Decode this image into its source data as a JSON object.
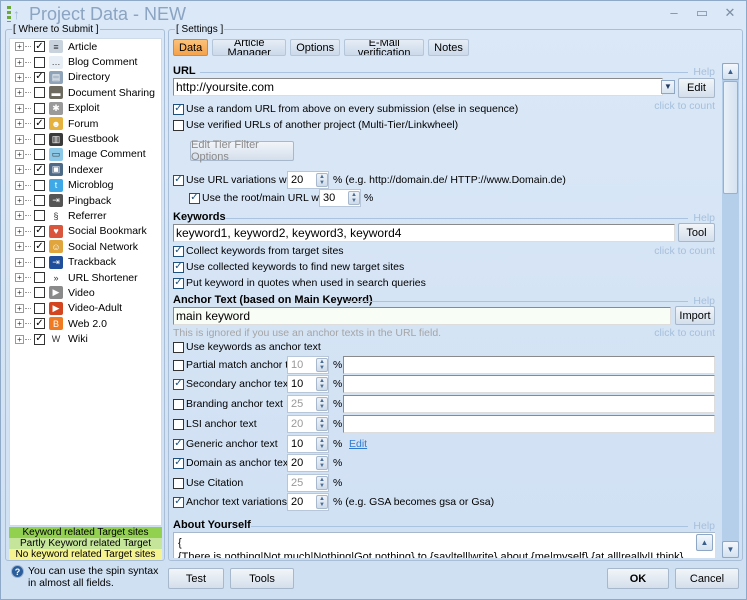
{
  "window": {
    "title": "Project Data - NEW",
    "controls": {
      "minimize": "–",
      "maximize": "▭",
      "close": "✕"
    }
  },
  "left_panel": {
    "group_label": "[ Where to Submit ]",
    "items": [
      {
        "label": "Article",
        "checked": true,
        "icon": "article-icon",
        "icon_color": "#c9d3de"
      },
      {
        "label": "Blog Comment",
        "checked": false,
        "icon": "speech-bubble-icon",
        "icon_color": "#e7eef6"
      },
      {
        "label": "Directory",
        "checked": true,
        "icon": "directory-icon",
        "icon_color": "#8fa3b9"
      },
      {
        "label": "Document Sharing",
        "checked": false,
        "icon": "folder-icon",
        "icon_color": "#6d6a5f"
      },
      {
        "label": "Exploit",
        "checked": false,
        "icon": "bug-icon",
        "icon_color": "#9a9a9a"
      },
      {
        "label": "Forum",
        "checked": true,
        "icon": "users-icon",
        "icon_color": "#e6b23f"
      },
      {
        "label": "Guestbook",
        "checked": false,
        "icon": "book-icon",
        "icon_color": "#3a3a3a"
      },
      {
        "label": "Image Comment",
        "checked": false,
        "icon": "image-icon",
        "icon_color": "#8cc8e8"
      },
      {
        "label": "Indexer",
        "checked": true,
        "icon": "indexer-icon",
        "icon_color": "#4d6a87"
      },
      {
        "label": "Microblog",
        "checked": false,
        "icon": "twitter-icon",
        "icon_color": "#3fa9e8"
      },
      {
        "label": "Pingback",
        "checked": false,
        "icon": "pingback-icon",
        "icon_color": "#555555"
      },
      {
        "label": "Referrer",
        "checked": false,
        "icon": "referrer-icon",
        "icon_color": "#ffffff"
      },
      {
        "label": "Social Bookmark",
        "checked": true,
        "icon": "heart-icon",
        "icon_color": "#d9553c"
      },
      {
        "label": "Social Network",
        "checked": true,
        "icon": "people-icon",
        "icon_color": "#e0a53d"
      },
      {
        "label": "Trackback",
        "checked": false,
        "icon": "trackback-icon",
        "icon_color": "#1f4f9a"
      },
      {
        "label": "URL Shortener",
        "checked": false,
        "icon": "chevrons-icon",
        "icon_color": "#ffffff"
      },
      {
        "label": "Video",
        "checked": false,
        "icon": "video-icon",
        "icon_color": "#8a8a8a"
      },
      {
        "label": "Video-Adult",
        "checked": false,
        "icon": "video-adult-icon",
        "icon_color": "#d2451e"
      },
      {
        "label": "Web 2.0",
        "checked": true,
        "icon": "blogger-icon",
        "icon_color": "#f07a21"
      },
      {
        "label": "Wiki",
        "checked": true,
        "icon": "wiki-icon",
        "icon_color": "#ffffff"
      }
    ],
    "legend": [
      {
        "label": "Keyword related Target sites",
        "color": "#92d050"
      },
      {
        "label": "Partly Keyword related Target sites",
        "color": "#c4e59a"
      },
      {
        "label": "No keyword related Target sites",
        "color": "#f5f38f"
      }
    ],
    "spin_hint": "You can use the spin syntax in almost all fields."
  },
  "settings": {
    "group_label": "[ Settings ]",
    "tabs": [
      {
        "label": "Data",
        "active": true
      },
      {
        "label": "Article Manager",
        "active": false
      },
      {
        "label": "Options",
        "active": false
      },
      {
        "label": "E-Mail verification",
        "active": false
      },
      {
        "label": "Notes",
        "active": false
      }
    ],
    "help_label": "Help",
    "click_to_count": "click to count",
    "url": {
      "title": "URL",
      "value": "http://yoursite.com",
      "edit_button": "Edit",
      "random_url": {
        "label": "Use a random URL from above on every submission (else in sequence)",
        "checked": true
      },
      "verified_urls": {
        "label": "Use verified URLs of another project (Multi-Tier/Linkwheel)",
        "checked": false
      },
      "tier_filter_button": "Edit Tier Filter Options",
      "url_variations": {
        "label": "Use URL variations with",
        "value": "20",
        "suffix": "% (e.g. http://domain.de/ HTTP://www.Domain.de)",
        "checked": true
      },
      "root_url": {
        "label": "Use the root/main URL with",
        "value": "30",
        "suffix": "%",
        "checked": true
      }
    },
    "keywords": {
      "title": "Keywords",
      "value": "keyword1, keyword2, keyword3, keyword4",
      "tool_button": "Tool",
      "options": [
        {
          "label": "Collect keywords from target sites",
          "checked": true
        },
        {
          "label": "Use collected keywords to find new target sites",
          "checked": true
        },
        {
          "label": "Put keyword in quotes when used in search queries",
          "checked": true
        }
      ]
    },
    "anchor": {
      "title": "Anchor Text (based on Main Keyword)",
      "value": "main keyword",
      "import_button": "Import",
      "note": "This is ignored if you use an anchor texts in the URL field.",
      "use_keywords": {
        "label": "Use keywords as anchor text",
        "checked": false
      },
      "rows": [
        {
          "label": "Partial match anchor text",
          "checked": false,
          "value": "10",
          "suffix": "%",
          "has_input": true,
          "input_value": ""
        },
        {
          "label": "Secondary anchor text",
          "checked": true,
          "value": "10",
          "suffix": "%",
          "has_input": true,
          "input_value": ""
        },
        {
          "label": "Branding anchor text",
          "checked": false,
          "value": "25",
          "suffix": "%",
          "has_input": true,
          "input_value": ""
        },
        {
          "label": "LSI anchor text",
          "checked": false,
          "value": "20",
          "suffix": "%",
          "has_input": true,
          "input_value": ""
        },
        {
          "label": "Generic anchor text",
          "checked": true,
          "value": "10",
          "suffix": "%",
          "has_input": false,
          "link": "Edit"
        },
        {
          "label": "Domain as anchor text",
          "checked": true,
          "value": "20",
          "suffix": "%",
          "has_input": false
        },
        {
          "label": "Use Citation",
          "checked": false,
          "value": "25",
          "suffix": "%",
          "has_input": false
        },
        {
          "label": "Anchor text variations",
          "checked": true,
          "value": "20",
          "suffix": "% (e.g. GSA becomes gsa or Gsa)",
          "has_input": false
        }
      ]
    },
    "about": {
      "title": "About Yourself",
      "line1": "{",
      "line2": "{There is nothing|Not much|Nothing|Got nothing} to {say|tell|write} about {me|myself} {at all|really|I think}"
    }
  },
  "footer": {
    "test_button": "Test",
    "tools_button": "Tools",
    "ok_button": "OK",
    "cancel_button": "Cancel"
  }
}
